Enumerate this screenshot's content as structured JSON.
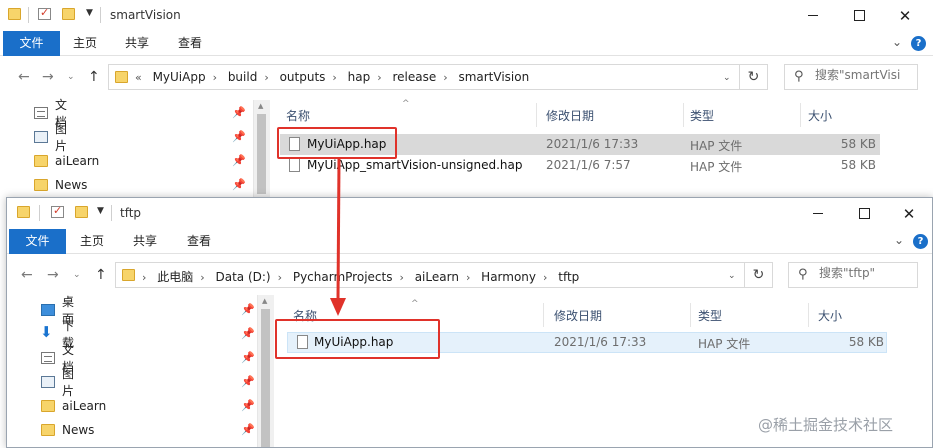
{
  "window_top": {
    "title": "smartVision",
    "ribbon": {
      "file": "文件",
      "home": "主页",
      "share": "共享",
      "view": "查看"
    },
    "breadcrumb_overflow": "«",
    "breadcrumbs": [
      "MyUiApp",
      "build",
      "outputs",
      "hap",
      "release",
      "smartVision"
    ],
    "search_placeholder": "搜索\"smartVisi",
    "nav_items": [
      "文档",
      "图片",
      "aiLearn",
      "News"
    ],
    "columns": {
      "name": "名称",
      "date": "修改日期",
      "type": "类型",
      "size": "大小"
    },
    "files": [
      {
        "name": "MyUiApp.hap",
        "date": "2021/1/6 17:33",
        "type": "HAP 文件",
        "size": "58 KB"
      },
      {
        "name": "MyUiApp_smartVision-unsigned.hap",
        "date": "2021/1/6 7:57",
        "type": "HAP 文件",
        "size": "58 KB"
      }
    ]
  },
  "window_bottom": {
    "title": "tftp",
    "ribbon": {
      "file": "文件",
      "home": "主页",
      "share": "共享",
      "view": "查看"
    },
    "breadcrumbs": [
      "此电脑",
      "Data (D:)",
      "PycharmProjects",
      "aiLearn",
      "Harmony",
      "tftp"
    ],
    "search_placeholder": "搜索\"tftp\"",
    "nav_items": [
      "桌面",
      "下载",
      "文档",
      "图片",
      "aiLearn",
      "News"
    ],
    "columns": {
      "name": "名称",
      "date": "修改日期",
      "type": "类型",
      "size": "大小"
    },
    "files": [
      {
        "name": "MyUiApp.hap",
        "date": "2021/1/6 17:33",
        "type": "HAP 文件",
        "size": "58 KB"
      }
    ]
  },
  "watermark": "@稀土掘金技术社区",
  "colors": {
    "accent": "#1a6fc9",
    "highlight": "#e0322a",
    "selection": "#d9d9d9",
    "selection_bottom": "#e5f1fb"
  }
}
